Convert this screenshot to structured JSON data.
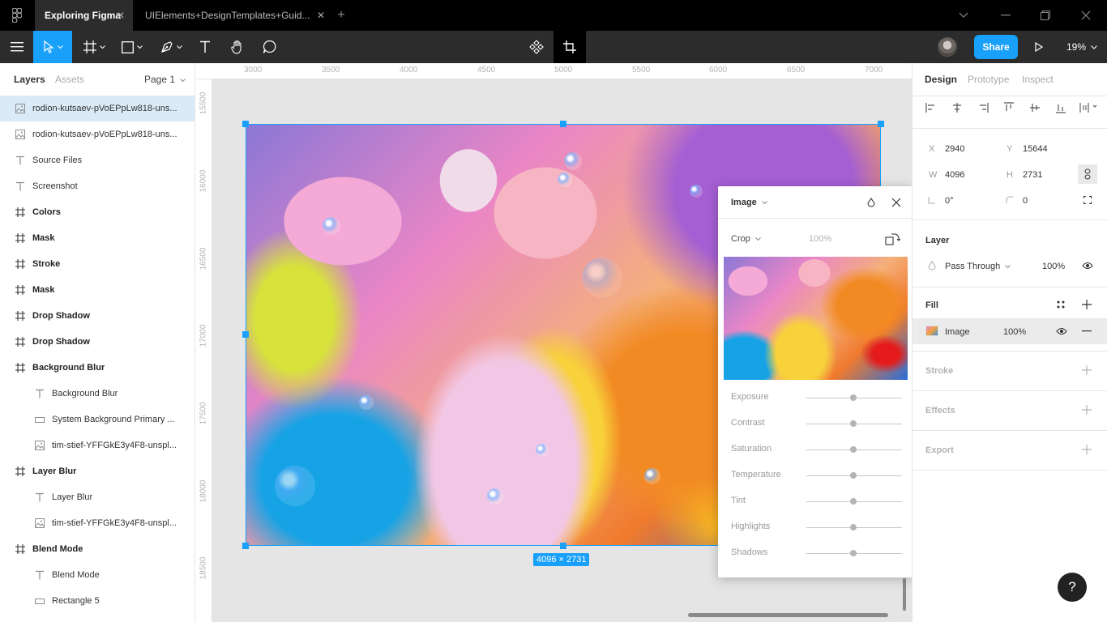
{
  "tabs": [
    {
      "label": "Exploring Figma",
      "active": true
    },
    {
      "label": "UIElements+DesignTemplates+Guid...",
      "active": false
    }
  ],
  "toolbar": {
    "share_label": "Share",
    "zoom": "19%"
  },
  "left_panel": {
    "tabs": [
      "Layers",
      "Assets"
    ],
    "page": "Page 1",
    "layers": [
      {
        "name": "rodion-kutsaev-pVoEPpLw818-uns...",
        "type": "image",
        "indent": 0,
        "selected": true
      },
      {
        "name": "rodion-kutsaev-pVoEPpLw818-uns...",
        "type": "image",
        "indent": 0
      },
      {
        "name": "Source Files",
        "type": "text",
        "indent": 0
      },
      {
        "name": "Screenshot",
        "type": "text",
        "indent": 0
      },
      {
        "name": "Colors",
        "type": "frame",
        "indent": 0
      },
      {
        "name": "Mask",
        "type": "frame",
        "indent": 0
      },
      {
        "name": "Stroke",
        "type": "frame",
        "indent": 0
      },
      {
        "name": "Mask",
        "type": "frame",
        "indent": 0
      },
      {
        "name": "Drop Shadow",
        "type": "frame",
        "indent": 0
      },
      {
        "name": "Drop Shadow",
        "type": "frame",
        "indent": 0
      },
      {
        "name": "Background Blur",
        "type": "frame",
        "indent": 0
      },
      {
        "name": "Background Blur",
        "type": "text",
        "indent": 1
      },
      {
        "name": "System Background Primary ...",
        "type": "rect",
        "indent": 1
      },
      {
        "name": "tim-stief-YFFGkE3y4F8-unspl...",
        "type": "image",
        "indent": 1
      },
      {
        "name": "Layer Blur",
        "type": "frame",
        "indent": 0
      },
      {
        "name": "Layer Blur",
        "type": "text",
        "indent": 1
      },
      {
        "name": "tim-stief-YFFGkE3y4F8-unspl...",
        "type": "image",
        "indent": 1
      },
      {
        "name": "Blend Mode",
        "type": "frame",
        "indent": 0
      },
      {
        "name": "Blend Mode",
        "type": "text",
        "indent": 1
      },
      {
        "name": "Rectangle 5",
        "type": "rect",
        "indent": 1
      }
    ]
  },
  "canvas": {
    "ruler_top": [
      "3000",
      "3500",
      "4000",
      "4500",
      "5000",
      "5500",
      "6000",
      "6500",
      "7000"
    ],
    "ruler_left": [
      "15500",
      "16000",
      "16500",
      "17000",
      "17500",
      "18000",
      "18500"
    ],
    "dimensions_badge": "4096 × 2731"
  },
  "image_popup": {
    "title": "Image",
    "mode": "Crop",
    "percent": "100%",
    "adjustments": [
      "Exposure",
      "Contrast",
      "Saturation",
      "Temperature",
      "Tint",
      "Highlights",
      "Shadows"
    ]
  },
  "right_panel": {
    "tabs": [
      "Design",
      "Prototype",
      "Inspect"
    ],
    "x_label": "X",
    "x": "2940",
    "y_label": "Y",
    "y": "15644",
    "w_label": "W",
    "w": "4096",
    "h_label": "H",
    "h": "2731",
    "rotation": "0°",
    "radius": "0",
    "layer_title": "Layer",
    "blend_mode": "Pass Through",
    "layer_opacity": "100%",
    "fill_title": "Fill",
    "fill_type": "Image",
    "fill_opacity": "100%",
    "stroke_title": "Stroke",
    "effects_title": "Effects",
    "export_title": "Export"
  },
  "help_label": "?",
  "colors": {
    "accent": "#18a0fb",
    "titlebar": "#000000",
    "toolbar": "#2c2c2c"
  }
}
